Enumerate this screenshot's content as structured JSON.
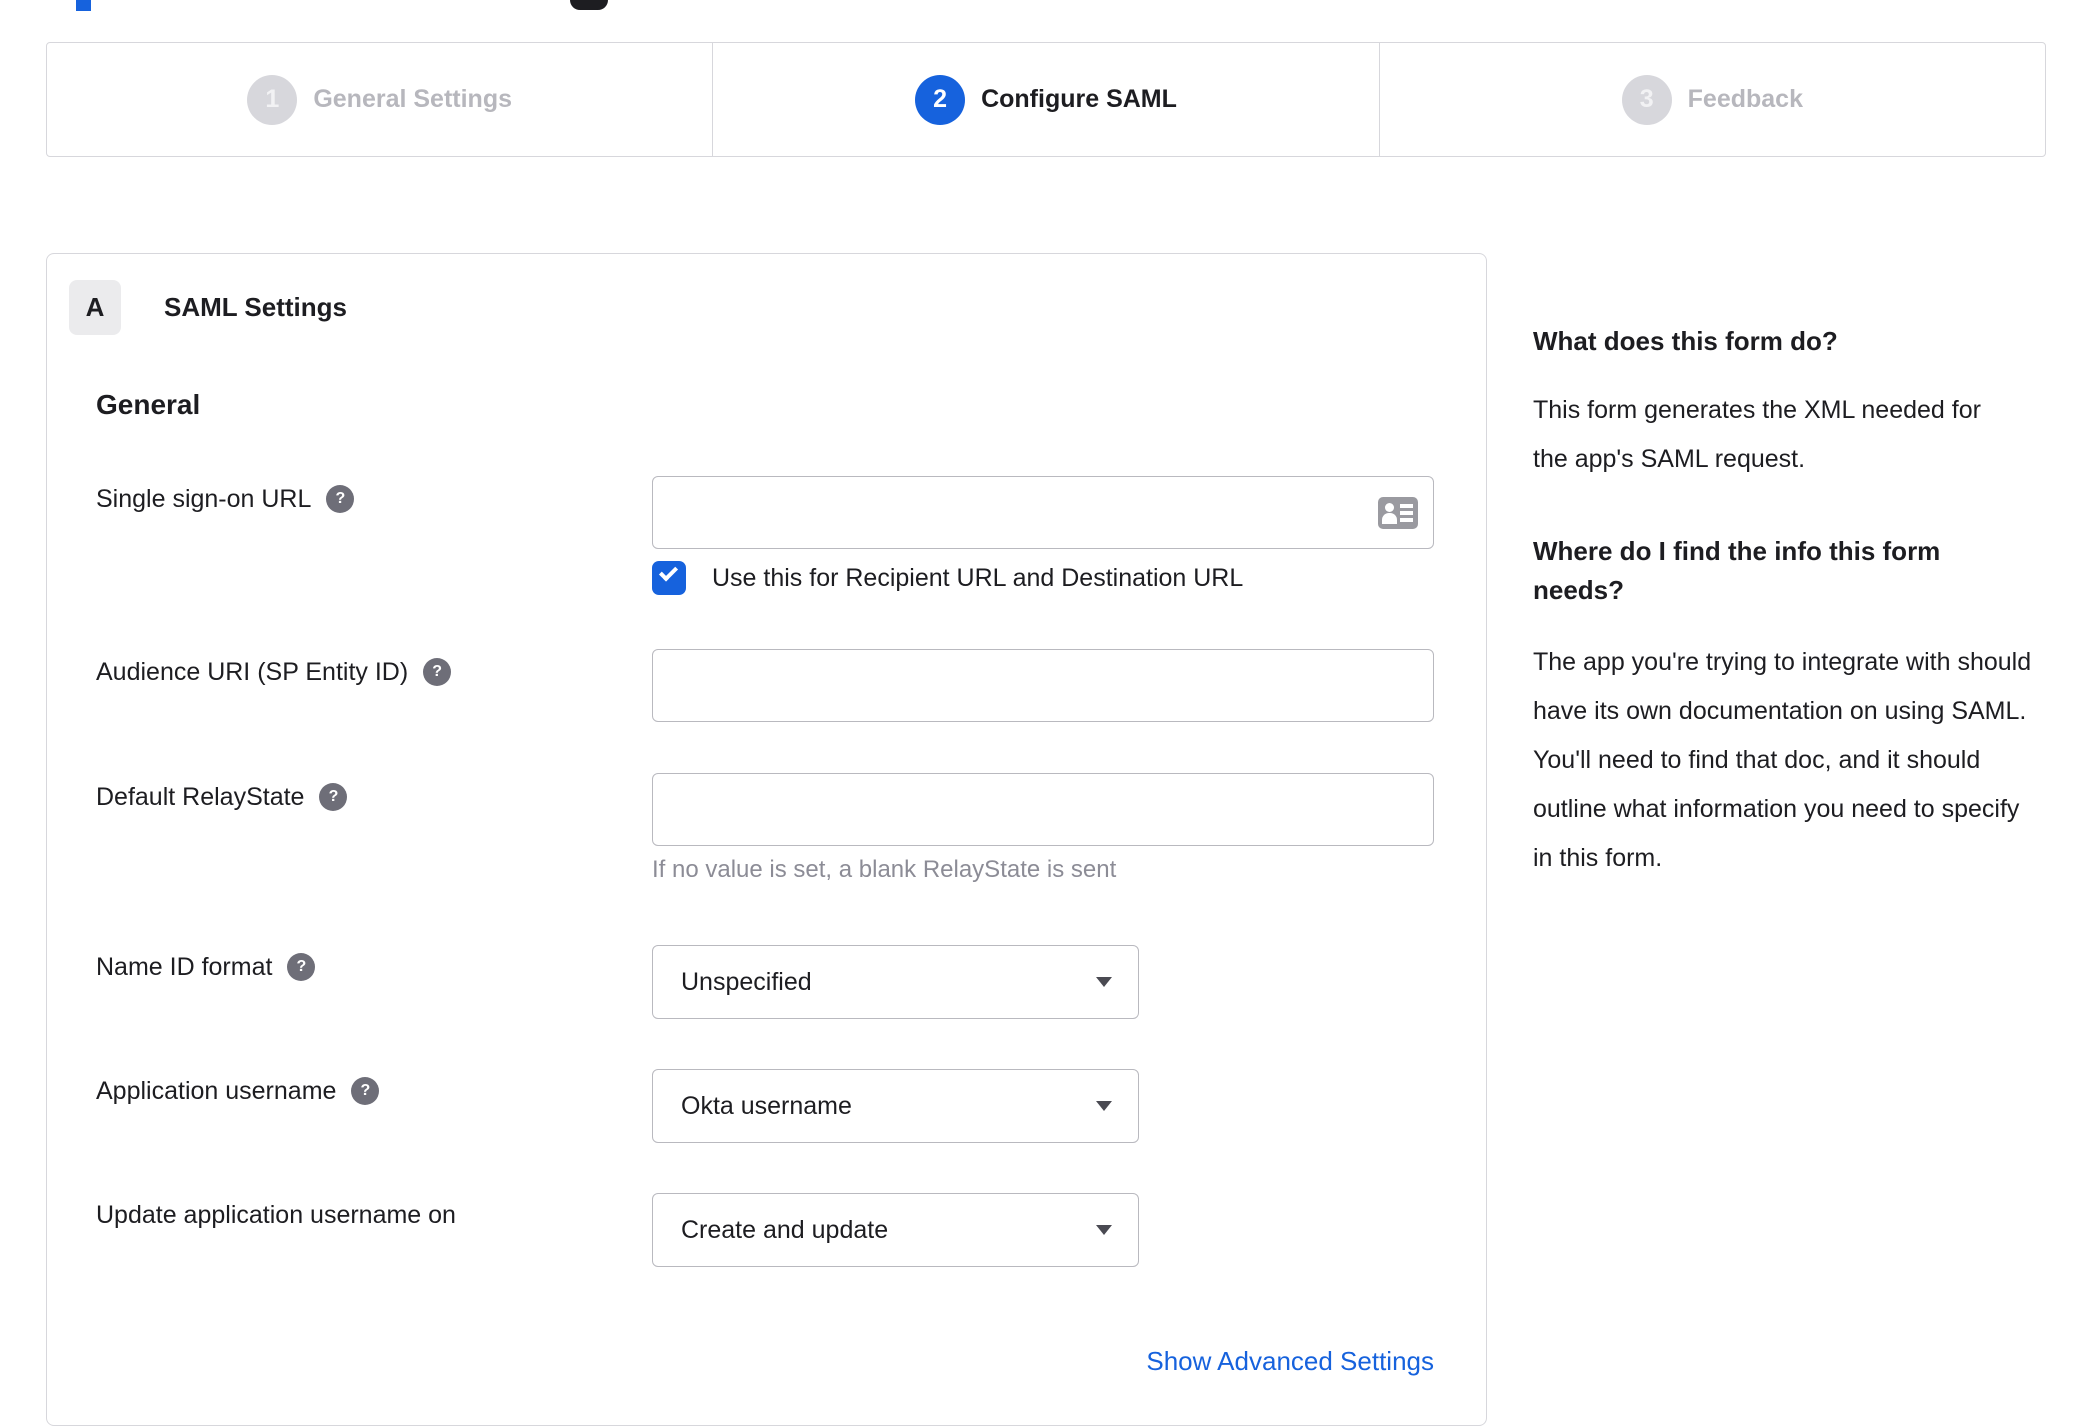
{
  "glyphs": {
    "help": "?"
  },
  "colors": {
    "accent_blue": "#1662dd",
    "inactive_gray": "#d7d7dc",
    "border_gray": "#d7d7dc",
    "input_border": "#b9b9bf",
    "text_dark": "#1d1d21",
    "muted_text": "#8c8c96",
    "help_bg": "#6e6e78",
    "link_blue": "#1662dd"
  },
  "stepper": {
    "steps": [
      {
        "number": "1",
        "label": "General Settings",
        "state": "inactive"
      },
      {
        "number": "2",
        "label": "Configure SAML",
        "state": "active"
      },
      {
        "number": "3",
        "label": "Feedback",
        "state": "inactive"
      }
    ]
  },
  "panel": {
    "badge": "A",
    "title": "SAML Settings",
    "section": "General",
    "fields": {
      "sso": {
        "label": "Single sign-on URL",
        "value": "",
        "checkbox_label": "Use this for Recipient URL and Destination URL",
        "checkbox_checked": true
      },
      "audience": {
        "label": "Audience URI (SP Entity ID)",
        "value": ""
      },
      "relay": {
        "label": "Default RelayState",
        "value": "",
        "hint": "If no value is set, a blank RelayState is sent"
      },
      "name_id": {
        "label": "Name ID format",
        "value": "Unspecified"
      },
      "app_username": {
        "label": "Application username",
        "value": "Okta username"
      },
      "update_username": {
        "label": "Update application username on",
        "value": "Create and update"
      }
    },
    "advanced_link": "Show Advanced Settings"
  },
  "sidebar": {
    "q1_title": "What does this form do?",
    "q1_body": "This form generates the XML needed for the app's SAML request.",
    "q2_title": "Where do I find the info this form needs?",
    "q2_body": "The app you're trying to integrate with should have its own documentation on using SAML. You'll need to find that doc, and it should outline what information you need to specify in this form."
  }
}
